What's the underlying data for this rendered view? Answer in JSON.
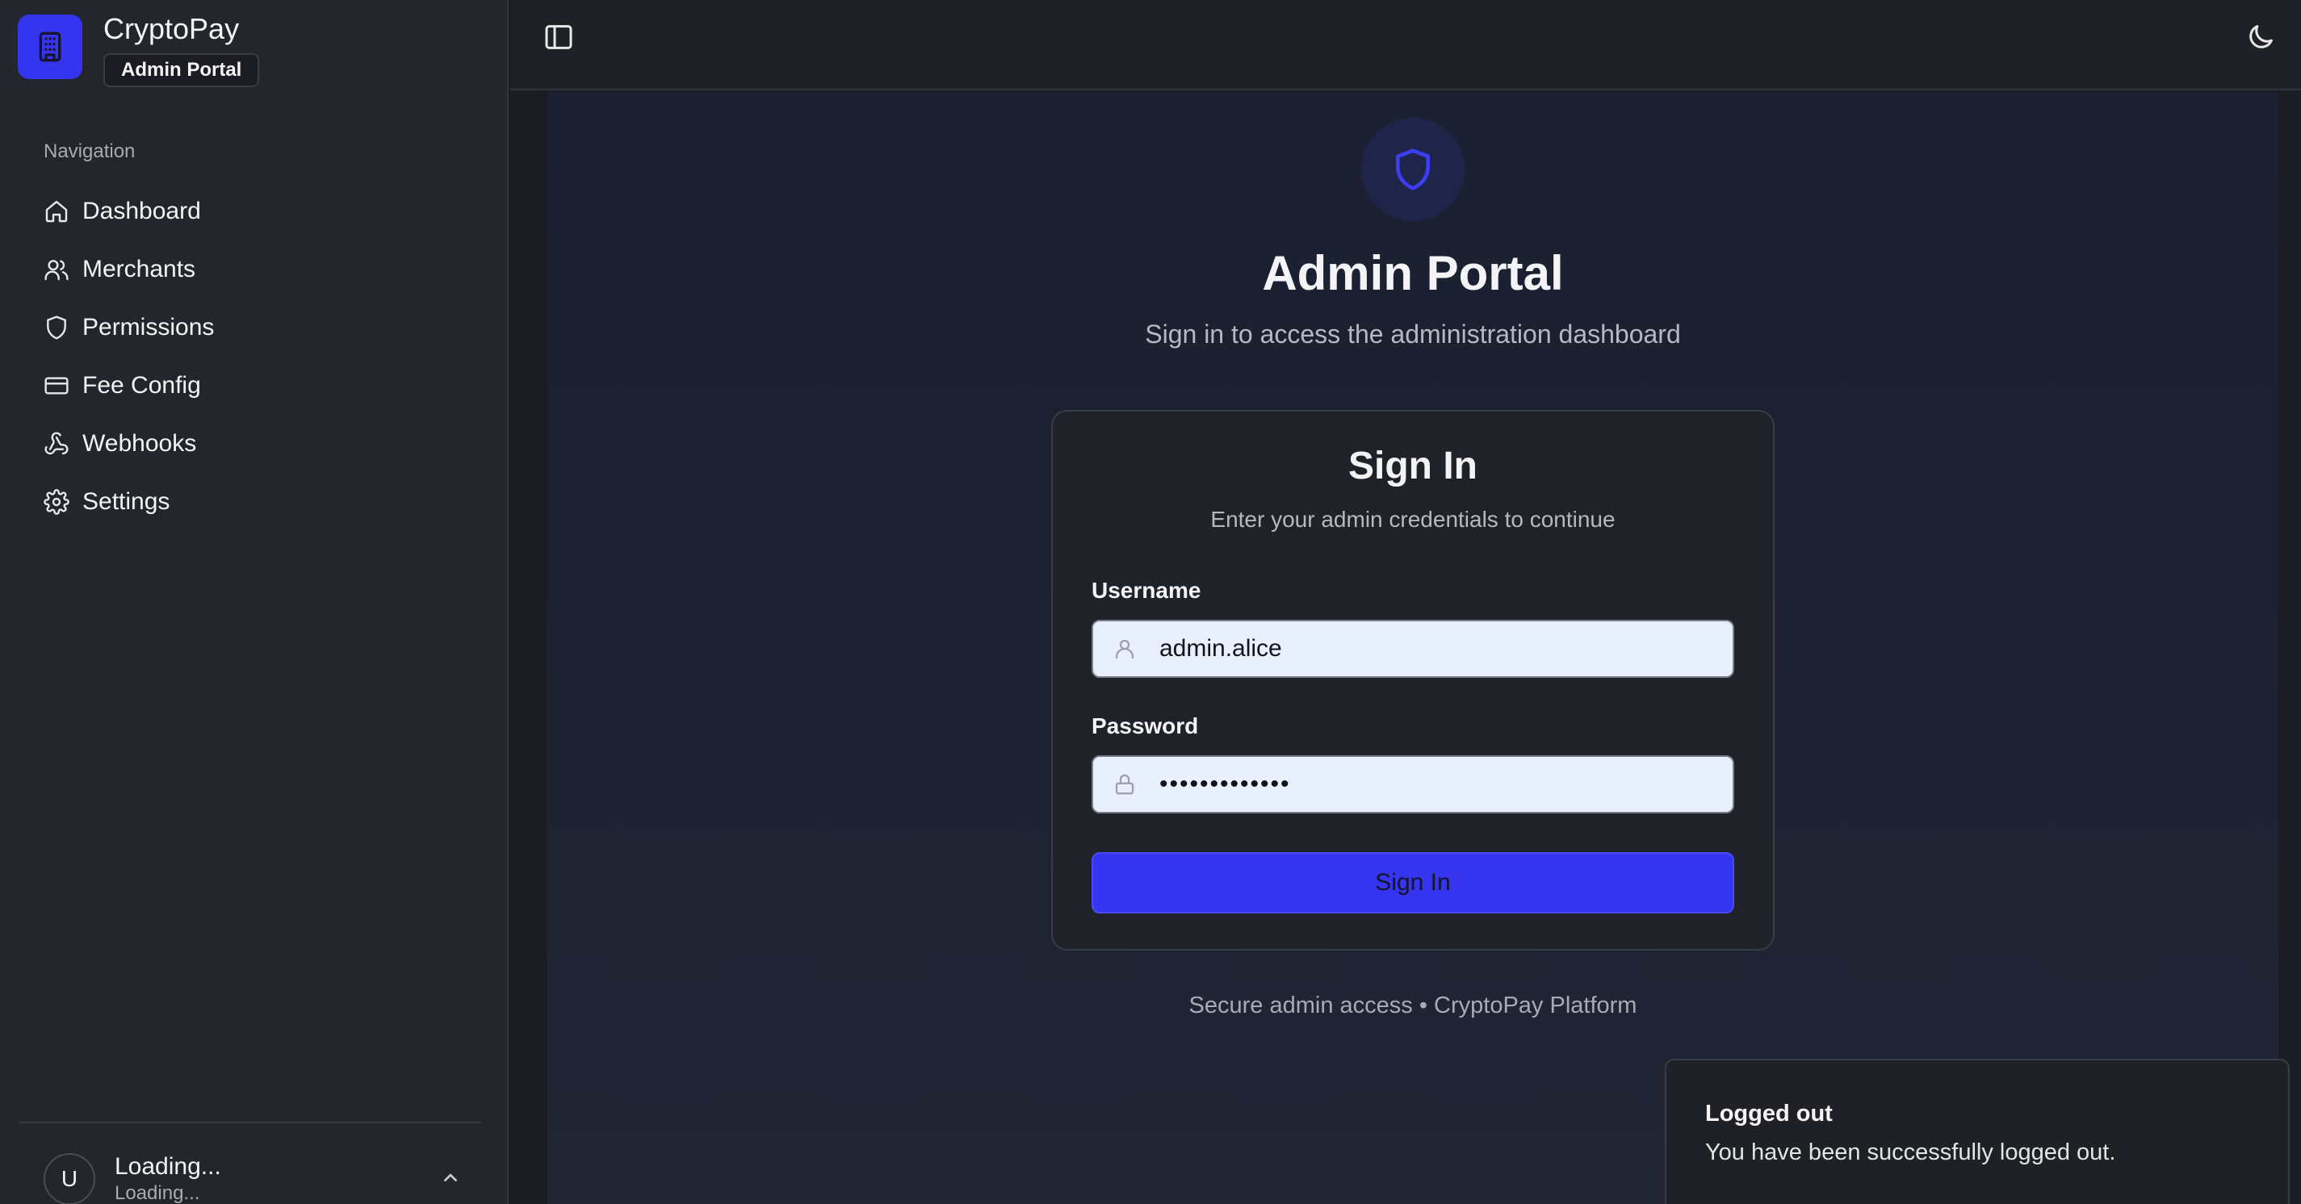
{
  "brand": {
    "name": "CryptoPay",
    "badge": "Admin Portal"
  },
  "sidebar": {
    "heading": "Navigation",
    "items": [
      {
        "label": "Dashboard",
        "icon": "home-icon"
      },
      {
        "label": "Merchants",
        "icon": "users-icon"
      },
      {
        "label": "Permissions",
        "icon": "shield-icon"
      },
      {
        "label": "Fee Config",
        "icon": "credit-card-icon"
      },
      {
        "label": "Webhooks",
        "icon": "webhook-icon"
      },
      {
        "label": "Settings",
        "icon": "gear-icon"
      }
    ],
    "user": {
      "initial": "U",
      "name": "Loading...",
      "subtitle": "Loading..."
    }
  },
  "header": {
    "title": "Admin Portal",
    "subtitle": "Sign in to access the administration dashboard"
  },
  "signin_card": {
    "title": "Sign In",
    "description": "Enter your admin credentials to continue",
    "username_label": "Username",
    "username_value": "admin.alice",
    "password_label": "Password",
    "password_masked": "•••••••••••••",
    "submit_label": "Sign In"
  },
  "footer": {
    "note": "Secure admin access • CryptoPay Platform"
  },
  "toast": {
    "title": "Logged out",
    "message": "You have been successfully logged out."
  },
  "colors": {
    "accent": "#3535f0",
    "background": "#1a1c21",
    "sidebar": "#23262d",
    "input_bg": "#e8f0fe"
  }
}
